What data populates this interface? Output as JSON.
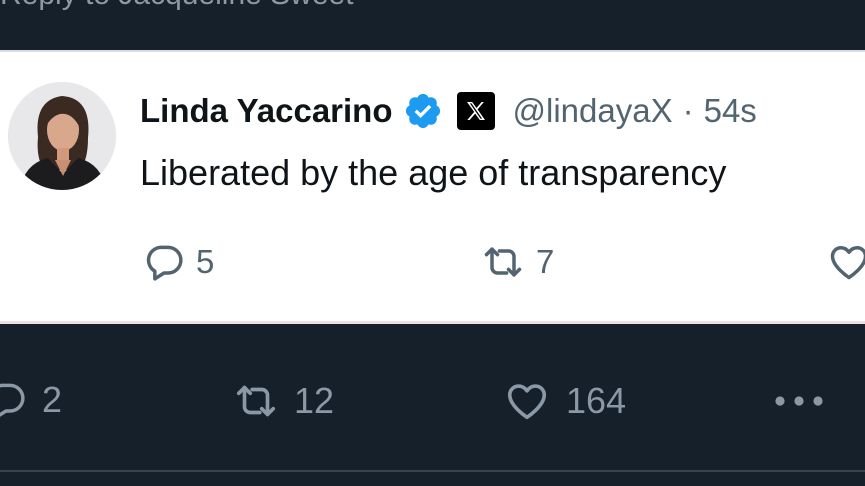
{
  "reply_context": {
    "text": "Reply to Jacqueline Sweet"
  },
  "quoted_tweet": {
    "author_name": "Linda Yaccarino",
    "verified_icon": "verified-badge-icon",
    "affiliate_badge_icon": "x-logo-icon",
    "handle": "@lindayaX",
    "separator": "·",
    "timestamp": "54s",
    "text": "Liberated by the age of transparency",
    "actions": {
      "replies": "5",
      "reposts": "7"
    }
  },
  "main_actions": {
    "replies": "2",
    "reposts": "12",
    "likes": "164"
  },
  "colors": {
    "background": "#15202b",
    "card_background": "#ffffff",
    "verified_blue": "#1d9bf0",
    "muted_text": "#8b98a5"
  }
}
